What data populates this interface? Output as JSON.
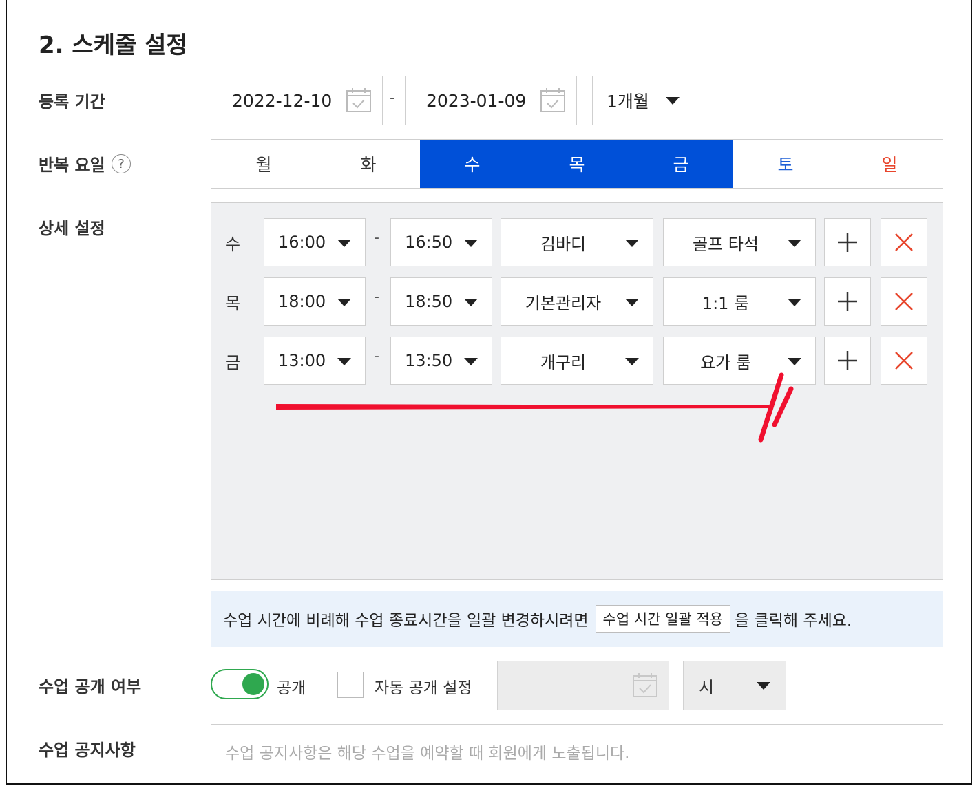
{
  "section_title": "2. 스케줄 설정",
  "period": {
    "label": "등록 기간",
    "start": "2022-12-10",
    "separator": "-",
    "end": "2023-01-09",
    "duration": "1개월"
  },
  "repeat": {
    "label": "반복 요일",
    "help": "?",
    "days": [
      {
        "label": "월",
        "selected": false,
        "color": "#333333"
      },
      {
        "label": "화",
        "selected": false,
        "color": "#333333"
      },
      {
        "label": "수",
        "selected": true,
        "color": "#ffffff"
      },
      {
        "label": "목",
        "selected": true,
        "color": "#ffffff"
      },
      {
        "label": "금",
        "selected": true,
        "color": "#ffffff"
      },
      {
        "label": "토",
        "selected": false,
        "color": "#1e5fd6"
      },
      {
        "label": "일",
        "selected": false,
        "color": "#e8452c"
      }
    ],
    "selected_color": "#0050d8"
  },
  "detail": {
    "label": "상세 설정",
    "rows": [
      {
        "day": "수",
        "start": "16:00",
        "end": "16:50",
        "instructor": "김바디",
        "room": "골프 타석"
      },
      {
        "day": "목",
        "start": "18:00",
        "end": "18:50",
        "instructor": "기본관리자",
        "room": "1:1 룸"
      },
      {
        "day": "금",
        "start": "13:00",
        "end": "13:50",
        "instructor": "개구리",
        "room": "요가 룸"
      }
    ],
    "separator": "-"
  },
  "notice": {
    "before": "수업 시간에 비례해 수업 종료시간을 일괄 변경하시려면",
    "button": "수업 시간 일괄 적용",
    "after": "을 클릭해 주세요."
  },
  "visibility": {
    "label": "수업 공개 여부",
    "toggle_label": "공개",
    "toggle_on": true,
    "auto_label": "자동 공개 설정",
    "hour_value": "시"
  },
  "class_notice": {
    "label": "수업 공지사항",
    "placeholder": "수업 공지사항은 해당 수업을 예약할 때 회원에게 노출됩니다."
  },
  "colors": {
    "accent": "#0050d8",
    "toggle": "#2fa84f",
    "delete": "#e8452c",
    "annotation": "#f0102f"
  }
}
